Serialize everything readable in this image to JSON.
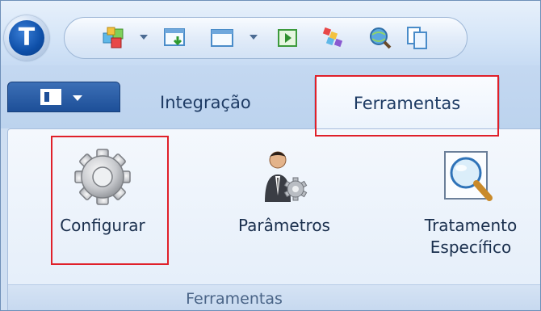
{
  "app": {
    "logo_letter": "T"
  },
  "quick_access": {
    "icons": [
      "cube-colors-icon",
      "download-window-icon",
      "window-icon",
      "export-green-icon",
      "palette-icon",
      "globe-search-icon",
      "copy-pages-icon"
    ]
  },
  "tabs": {
    "file_menu_icon": "panel-layout-icon",
    "items": [
      "Integração",
      "Ferramentas"
    ],
    "active_index": 1
  },
  "ribbon": {
    "buttons": [
      {
        "label": "Configurar",
        "icon": "gear-icon"
      },
      {
        "label": "Parâmetros",
        "icon": "person-gear-icon"
      },
      {
        "label_line1": "Tratamento",
        "label_line2": "Específico",
        "icon": "magnifier-icon"
      }
    ],
    "group_label": "Ferramentas"
  },
  "highlight_color": "#e0202a"
}
